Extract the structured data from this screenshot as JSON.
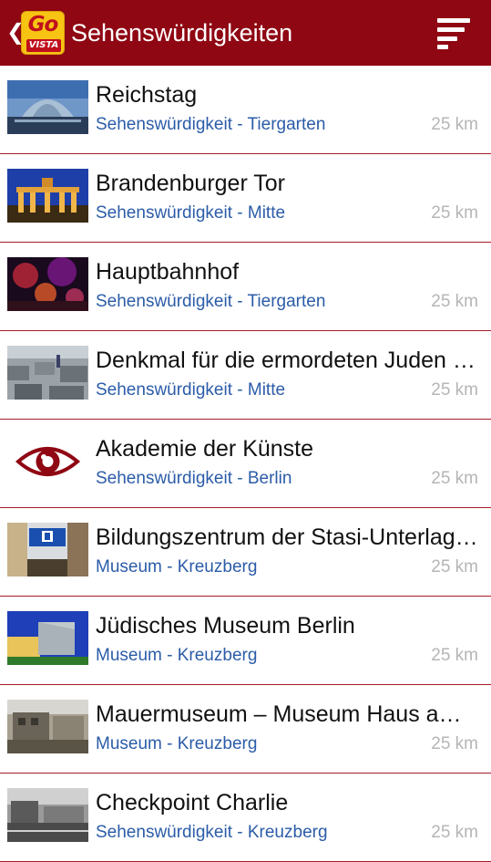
{
  "header": {
    "back_glyph": "❮",
    "logo_top": "Go",
    "logo_bottom": "VISTA",
    "title": "Sehenswürdigkeiten"
  },
  "colors": {
    "appbar": "#8f0713",
    "accent_text": "#2b5ca8",
    "distance_text": "#b5b5b5",
    "divider": "#a51b2a",
    "logo": "#f8c414"
  },
  "items": [
    {
      "name": "Reichstag",
      "subtitle": "Sehenswürdigkeit - Tiergarten",
      "distance": "25 km",
      "thumb": "reichstag-dome-photo"
    },
    {
      "name": "Brandenburger Tor",
      "subtitle": "Sehenswürdigkeit - Mitte",
      "distance": "25 km",
      "thumb": "brandenburg-gate-night-photo"
    },
    {
      "name": "Hauptbahnhof",
      "subtitle": "Sehenswürdigkeit - Tiergarten",
      "distance": "25 km",
      "thumb": "hauptbahnhof-fireworks-photo"
    },
    {
      "name": "Denkmal für die ermordeten Juden Europas",
      "subtitle": "Sehenswürdigkeit - Mitte",
      "distance": "25 km",
      "thumb": "holocaust-memorial-photo"
    },
    {
      "name": "Akademie der Künste",
      "subtitle": "Sehenswürdigkeit - Berlin",
      "distance": "25 km",
      "thumb": "eye-placeholder-icon"
    },
    {
      "name": "Bildungszentrum der Stasi-Unterlagen-Behörde",
      "subtitle": "Museum - Kreuzberg",
      "distance": "25 km",
      "thumb": "u-bahn-kochstrasse-photo"
    },
    {
      "name": "Jüdisches Museum Berlin",
      "subtitle": "Museum - Kreuzberg",
      "distance": "25 km",
      "thumb": "jewish-museum-photo"
    },
    {
      "name": "Mauermuseum – Museum Haus am Checkpoint Charlie",
      "subtitle": "Museum - Kreuzberg",
      "distance": "25 km",
      "thumb": "mauermuseum-photo"
    },
    {
      "name": "Checkpoint Charlie",
      "subtitle": "Sehenswürdigkeit - Kreuzberg",
      "distance": "25 km",
      "thumb": "checkpoint-charlie-photo"
    }
  ]
}
